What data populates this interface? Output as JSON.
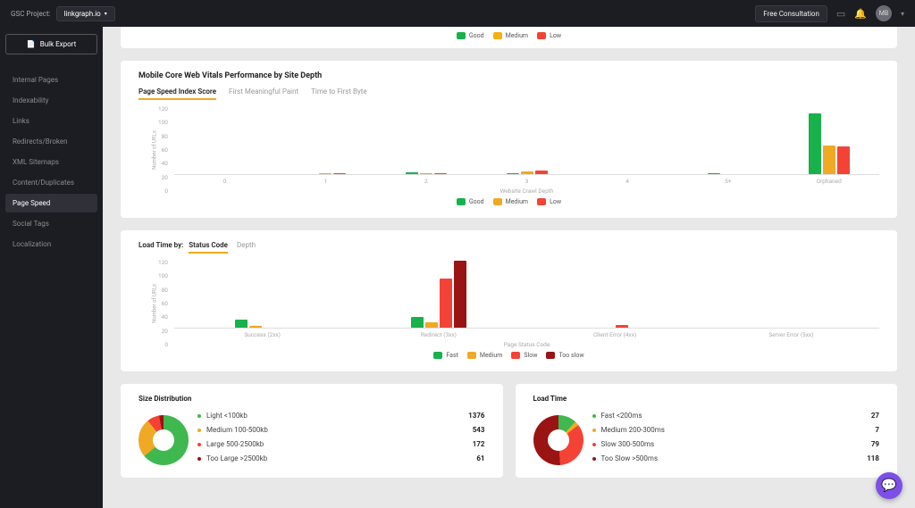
{
  "header": {
    "gsc_label": "GSC Project:",
    "gsc_project": "linkgraph.io",
    "free_consult": "Free Consultation",
    "avatar_initials": "MB"
  },
  "sidebar": {
    "bulk_export": "Bulk Export",
    "items": [
      {
        "label": "Internal Pages"
      },
      {
        "label": "Indexability"
      },
      {
        "label": "Links"
      },
      {
        "label": "Redirects/Broken"
      },
      {
        "label": "XML Sitemaps"
      },
      {
        "label": "Content/Duplicates"
      },
      {
        "label": "Page Speed"
      },
      {
        "label": "Social Tags"
      },
      {
        "label": "Localization"
      }
    ],
    "active_index": 6
  },
  "colors": {
    "good": "#18b14c",
    "medium": "#f0a924",
    "low": "#f44336",
    "too_slow": "#9a1414"
  },
  "top_legend": [
    "Good",
    "Medium",
    "Low"
  ],
  "chart_data": [
    {
      "type": "bar",
      "title": "Mobile Core Web Vitals Performance by Site Depth",
      "tabs": [
        "Page Speed Index Score",
        "First Meaningful Paint",
        "Time to First Byte"
      ],
      "active_tab": 0,
      "ylabel": "Number of URLs",
      "xlabel": "Website Crawl Depth",
      "yticks": [
        0,
        20,
        40,
        60,
        80,
        100,
        120
      ],
      "ylim": [
        0,
        120
      ],
      "categories": [
        "0",
        "1",
        "2",
        "3",
        "4",
        "5+",
        "Orphaned"
      ],
      "legend": [
        "Good",
        "Medium",
        "Low"
      ],
      "legend_colors": [
        "#18b14c",
        "#f0a924",
        "#f44336"
      ],
      "series": [
        {
          "name": "Good",
          "color": "#18b14c",
          "values": [
            0,
            0,
            3,
            2,
            0,
            1,
            105
          ]
        },
        {
          "name": "Medium",
          "color": "#f0a924",
          "values": [
            0,
            1,
            1,
            5,
            0,
            0,
            50
          ]
        },
        {
          "name": "Low",
          "color": "#f44336",
          "values": [
            0,
            2,
            1,
            6,
            0,
            0,
            48
          ]
        }
      ]
    },
    {
      "type": "bar",
      "title_prefix": "Load Time by:",
      "tabs": [
        "Status Code",
        "Depth"
      ],
      "active_tab": 0,
      "ylabel": "Number of URLs",
      "xlabel": "Page Status Code",
      "yticks": [
        0,
        20,
        40,
        60,
        80,
        100,
        120
      ],
      "ylim": [
        0,
        120
      ],
      "categories": [
        "Success (2xx)",
        "Redirect (3xx)",
        "Client Error (4xx)",
        "Server Error (5xx)"
      ],
      "legend": [
        "Fast",
        "Medium",
        "Slow",
        "Too slow"
      ],
      "legend_colors": [
        "#18b14c",
        "#f0a924",
        "#f44336",
        "#9a1414"
      ],
      "series": [
        {
          "name": "Fast",
          "color": "#18b14c",
          "values": [
            14,
            18,
            0,
            0
          ]
        },
        {
          "name": "Medium",
          "color": "#f0a924",
          "values": [
            3,
            10,
            0,
            0
          ]
        },
        {
          "name": "Slow",
          "color": "#f44336",
          "values": [
            0,
            85,
            4,
            0
          ]
        },
        {
          "name": "Too slow",
          "color": "#9a1414",
          "values": [
            0,
            115,
            0,
            0
          ]
        }
      ]
    }
  ],
  "size_dist": {
    "title": "Size Distribution",
    "items": [
      {
        "color": "#3fb84f",
        "label": "Light <100kb",
        "value": 1376
      },
      {
        "color": "#f0a924",
        "label": "Medium 100-500kb",
        "value": 543
      },
      {
        "color": "#f44336",
        "label": "Large 500-2500kb",
        "value": 172
      },
      {
        "color": "#9a1414",
        "label": "Too Large >2500kb",
        "value": 61
      }
    ]
  },
  "load_time": {
    "title": "Load Time",
    "items": [
      {
        "color": "#3fb84f",
        "label": "Fast <200ms",
        "value": 27
      },
      {
        "color": "#f0a924",
        "label": "Medium 200-300ms",
        "value": 7
      },
      {
        "color": "#f44336",
        "label": "Slow 300-500ms",
        "value": 79
      },
      {
        "color": "#9a1414",
        "label": "Too Slow >500ms",
        "value": 118
      }
    ]
  }
}
